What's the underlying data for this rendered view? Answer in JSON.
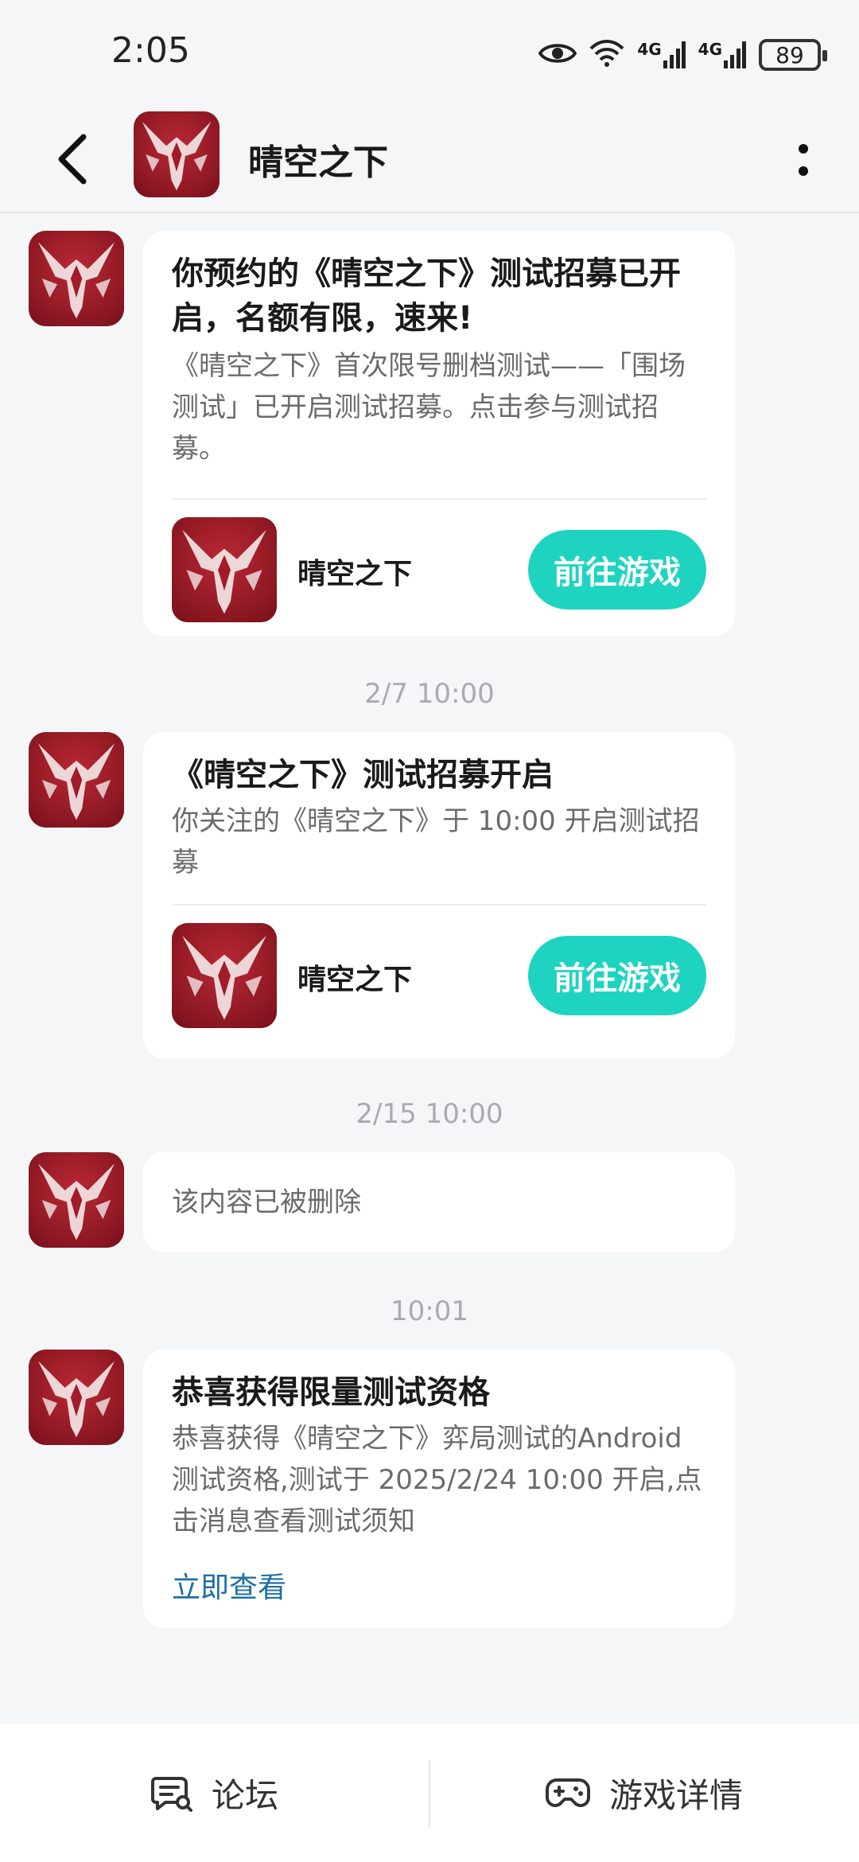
{
  "status_bar": {
    "time": "2:05",
    "battery": "89",
    "network_1": "4G",
    "network_2": "4G",
    "icons": [
      "eye-icon",
      "wifi-icon",
      "signal-4g-icon",
      "signal-4g-icon",
      "battery-icon"
    ]
  },
  "header": {
    "title": "晴空之下",
    "back_icon": "back-arrow-icon",
    "more_icon": "more-vertical-icon"
  },
  "messages": [
    {
      "title": "你预约的《晴空之下》测试招募已开启，名额有限，速来!",
      "body": "《晴空之下》首次限号删档测试——「围场测试」已开启测试招募。点击参与测试招募。",
      "game_name": "晴空之下",
      "button": "前往游戏"
    },
    {
      "timestamp": "2/7  10:00",
      "title": "《晴空之下》测试招募开启",
      "body": "你关注的《晴空之下》于 10:00 开启测试招募",
      "game_name": "晴空之下",
      "button": "前往游戏"
    },
    {
      "timestamp": "2/15  10:00",
      "body": "该内容已被删除"
    },
    {
      "timestamp": "10:01",
      "title": "恭喜获得限量测试资格",
      "body": "恭喜获得《晴空之下》弈局测试的Android测试资格,测试于 2025/2/24 10:00 开启,点击消息查看测试须知",
      "link": "立即查看"
    }
  ],
  "bottom_bar": {
    "forum_label": "论坛",
    "forum_icon": "forum-chat-icon",
    "details_label": "游戏详情",
    "details_icon": "gamepad-icon"
  },
  "colors": {
    "accent": "#1ed4c0",
    "link": "#1d6fa5",
    "background": "#f5f6f8",
    "avatar_red": "#b0212e"
  }
}
